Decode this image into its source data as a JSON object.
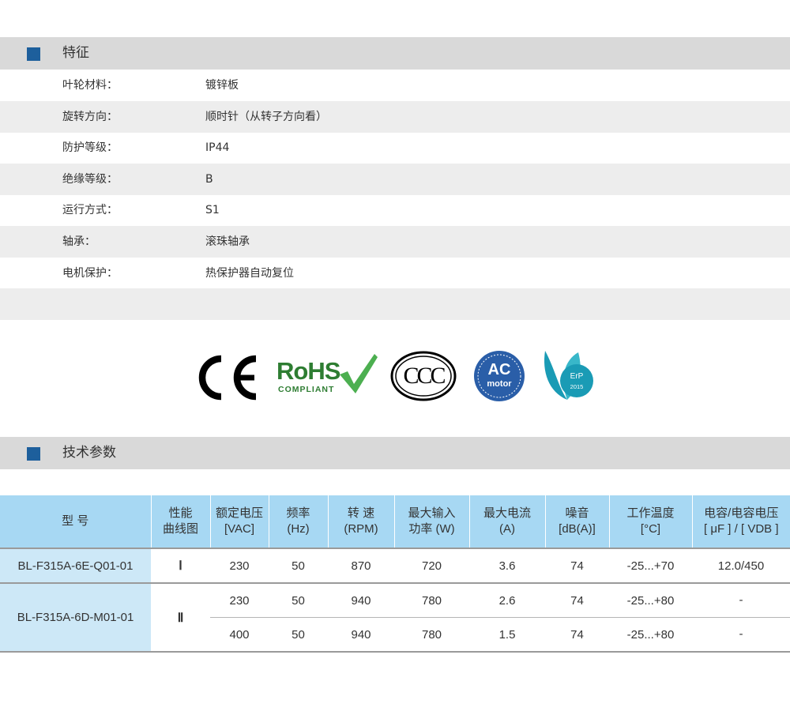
{
  "features": {
    "header": "特征",
    "rows": [
      {
        "label": "叶轮材料：",
        "value": "镀锌板"
      },
      {
        "label": "旋转方向：",
        "value": "顺时针（从转子方向看）"
      },
      {
        "label": "防护等级：",
        "value": "IP44"
      },
      {
        "label": "绝缘等级：",
        "value": "B"
      },
      {
        "label": "运行方式：",
        "value": "S1"
      },
      {
        "label": "轴承：",
        "value": "滚珠轴承"
      },
      {
        "label": "电机保护：",
        "value": "热保护器自动复位"
      }
    ]
  },
  "certifications": {
    "ce": "CE",
    "rohs": {
      "main": "RoHS",
      "sub": "COMPLIANT"
    },
    "ccc": "CCC",
    "ac_motor": {
      "top": "AC",
      "bottom": "motor"
    },
    "erp": {
      "top": "ErP",
      "bottom": "2015"
    }
  },
  "technical": {
    "header": "技术参数",
    "columns": [
      {
        "l1": "型 号",
        "l2": ""
      },
      {
        "l1": "性能",
        "l2": "曲线图"
      },
      {
        "l1": "额定电压",
        "l2": "[VAC]"
      },
      {
        "l1": "频率",
        "l2": "(Hz)"
      },
      {
        "l1": "转 速",
        "l2": "(RPM)"
      },
      {
        "l1": "最大输入",
        "l2": "功率 (W)"
      },
      {
        "l1": "最大电流",
        "l2": "(A)"
      },
      {
        "l1": "噪音",
        "l2": "[dB(A)]"
      },
      {
        "l1": "工作温度",
        "l2": "[°C]"
      },
      {
        "l1": "电容/电容电压",
        "l2": "[ μF ] / [ VDB ]"
      }
    ],
    "models": [
      {
        "model": "BL-F315A-6E-Q01-01",
        "curve": "Ⅰ",
        "rows": [
          {
            "voltage": "230",
            "freq": "50",
            "speed": "870",
            "power": "720",
            "current": "3.6",
            "noise": "74",
            "temp": "-25...+70",
            "cap": "12.0/450"
          }
        ]
      },
      {
        "model": "BL-F315A-6D-M01-01",
        "curve": "Ⅱ",
        "rows": [
          {
            "voltage": "230",
            "freq": "50",
            "speed": "940",
            "power": "780",
            "current": "2.6",
            "noise": "74",
            "temp": "-25...+80",
            "cap": "-"
          },
          {
            "voltage": "400",
            "freq": "50",
            "speed": "940",
            "power": "780",
            "current": "1.5",
            "noise": "74",
            "temp": "-25...+80",
            "cap": "-"
          }
        ]
      }
    ]
  },
  "colors": {
    "accent_square": "#1d5f9c",
    "header_bar": "#d9d9d9",
    "table_header": "#a7d8f3",
    "model_cell": "#cde8f7",
    "rohs_green": "#2e7d32",
    "ac_blue": "#2a5ea8",
    "erp_teal": "#1a9bb5"
  }
}
